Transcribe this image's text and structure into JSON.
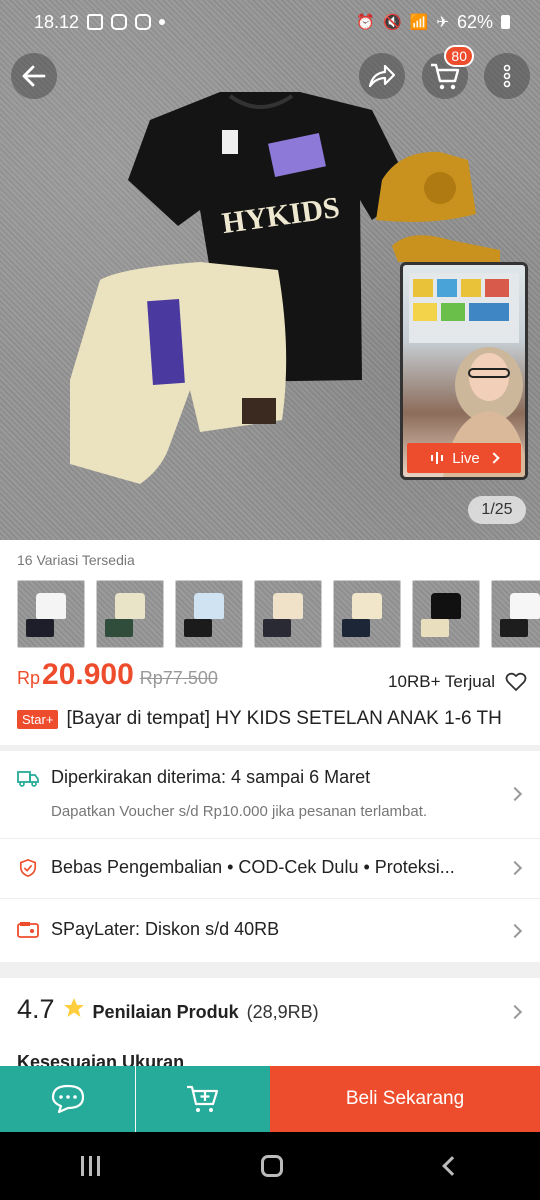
{
  "status": {
    "time": "18.12",
    "battery": "62%"
  },
  "header": {
    "cart_count": "80"
  },
  "gallery": {
    "counter": "1/25",
    "live_label": "Live"
  },
  "variants": {
    "title": "16 Variasi Tersedia",
    "thumbs": [
      {
        "shirt": "#f4f4f4",
        "shorts": "#1e1e2a"
      },
      {
        "shirt": "#e9e4c8",
        "shorts": "#2f4d3a"
      },
      {
        "shirt": "#cfe3f2",
        "shorts": "#1b1b1b"
      },
      {
        "shirt": "#efe2c8",
        "shorts": "#2a2a35"
      },
      {
        "shirt": "#f1e6c9",
        "shorts": "#1c2636"
      },
      {
        "shirt": "#111111",
        "shorts": "#e9dfbf"
      },
      {
        "shirt": "#f6f6f6",
        "shorts": "#1d1d1d"
      }
    ]
  },
  "product": {
    "currency": "Rp",
    "price": "20.900",
    "original_price": "Rp77.500",
    "sold": "10RB+ Terjual",
    "badge": "Star+",
    "title": "[Bayar di tempat] HY KIDS SETELAN ANAK 1-6 TH"
  },
  "shipping": {
    "text": "Diperkirakan diterima: 4 sampai 6 Maret",
    "subtext": "Dapatkan Voucher s/d Rp10.000 jika pesanan terlambat."
  },
  "guarantee": {
    "text": "Bebas Pengembalian  •  COD-Cek Dulu  •  Proteksi..."
  },
  "paylater": {
    "text": "SPayLater: Diskon s/d 40RB"
  },
  "rating": {
    "score": "4.7",
    "label": "Penilaian Produk",
    "count": "(28,9RB)",
    "next_section": "Kesesuaian Ukuran"
  },
  "actions": {
    "buy_label": "Beli Sekarang"
  },
  "colors": {
    "accent": "#ee4d2d",
    "teal": "#26aa99"
  }
}
